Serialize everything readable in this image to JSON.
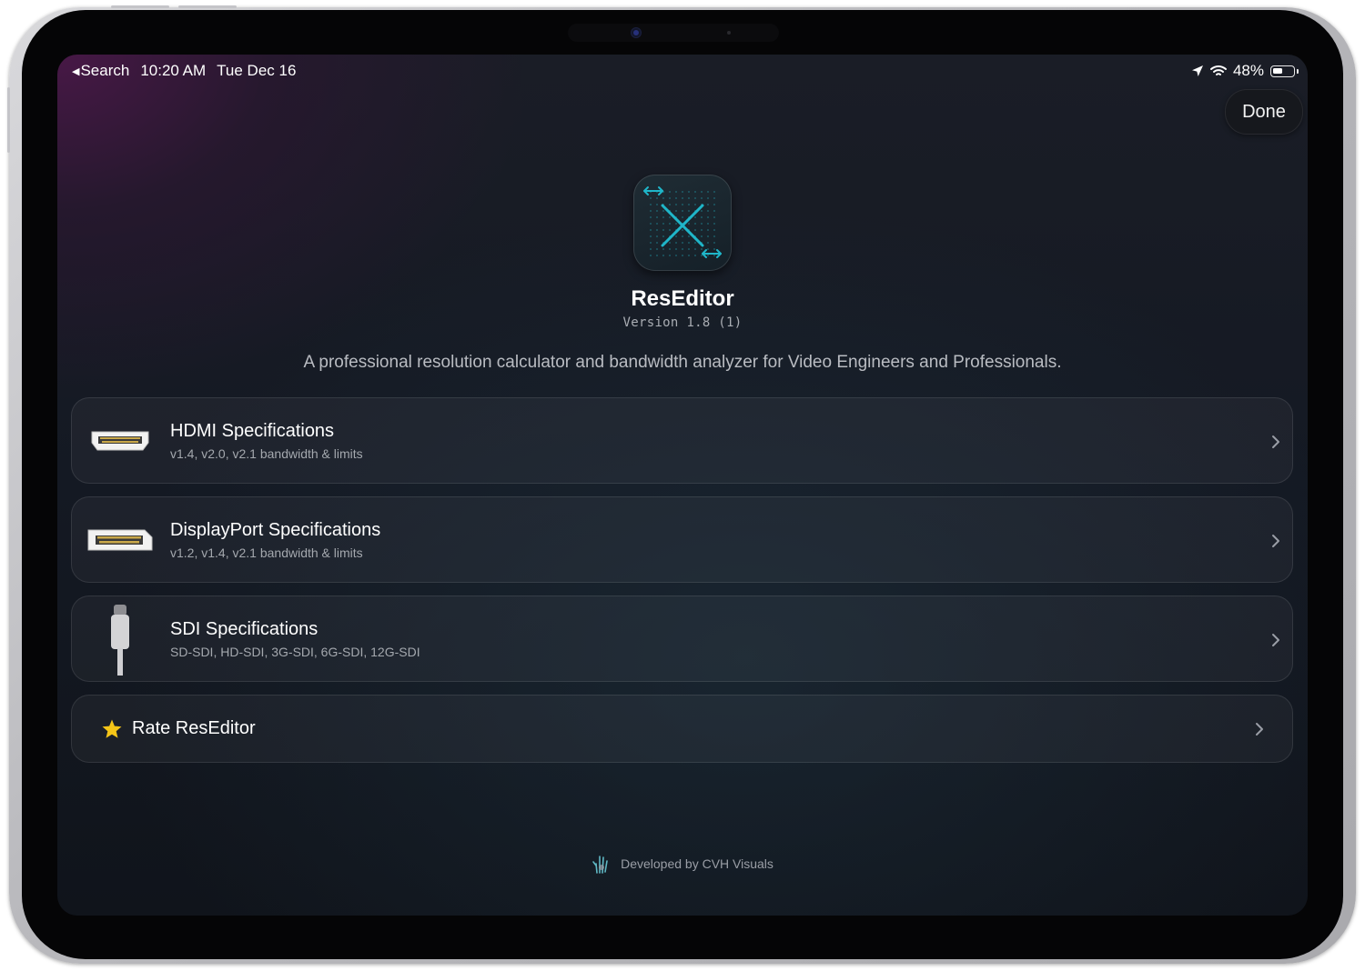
{
  "status_bar": {
    "back_label": "Search",
    "time": "10:20 AM",
    "date": "Tue Dec 16",
    "battery_percent": "48%",
    "battery_level": 0.48
  },
  "header": {
    "done_label": "Done"
  },
  "app": {
    "name": "ResEditor",
    "version": "Version 1.8 (1)",
    "description": "A professional resolution calculator and bandwidth analyzer for Video Engineers and Professionals."
  },
  "menu": {
    "items": [
      {
        "title": "HDMI Specifications",
        "subtitle": "v1.4, v2.0, v2.1 bandwidth & limits",
        "icon": "hdmi-connector-icon"
      },
      {
        "title": "DisplayPort Specifications",
        "subtitle": "v1.2, v1.4, v2.1 bandwidth & limits",
        "icon": "displayport-connector-icon"
      },
      {
        "title": "SDI Specifications",
        "subtitle": "SD-SDI, HD-SDI, 3G-SDI, 6G-SDI, 12G-SDI",
        "icon": "sdi-connector-icon"
      }
    ],
    "rate": {
      "label": "Rate ResEditor",
      "icon": "star-icon"
    }
  },
  "footer": {
    "text": "Developed by CVH Visuals",
    "icon": "hand-logo-icon"
  },
  "colors": {
    "accent_cyan": "#1fb6c9",
    "star_yellow": "#f5c518",
    "background": "#141923"
  }
}
